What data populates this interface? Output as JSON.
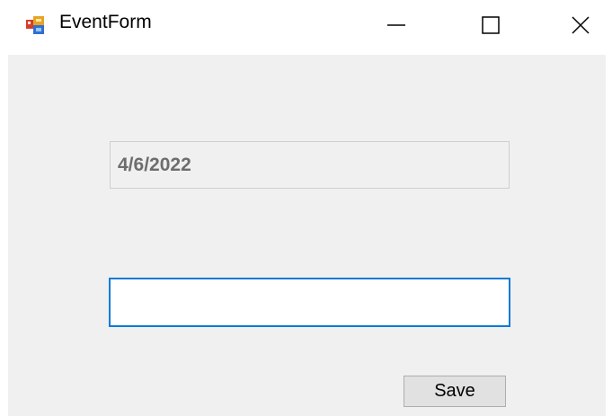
{
  "window": {
    "title": "EventForm",
    "app_icon": "winforms-app-icon",
    "controls": {
      "minimize_icon": "minimize-icon",
      "maximize_icon": "maximize-icon",
      "close_icon": "close-icon"
    }
  },
  "form": {
    "date_display": {
      "value": "4/6/2022",
      "enabled": false
    },
    "text_input": {
      "value": "",
      "placeholder": "",
      "focused": true
    },
    "save_button": {
      "label": "Save"
    }
  },
  "colors": {
    "client_background": "#f0f0f0",
    "focus_border": "#0a7ad8",
    "disabled_text": "#6d6d6d",
    "button_face": "#e1e1e1"
  }
}
